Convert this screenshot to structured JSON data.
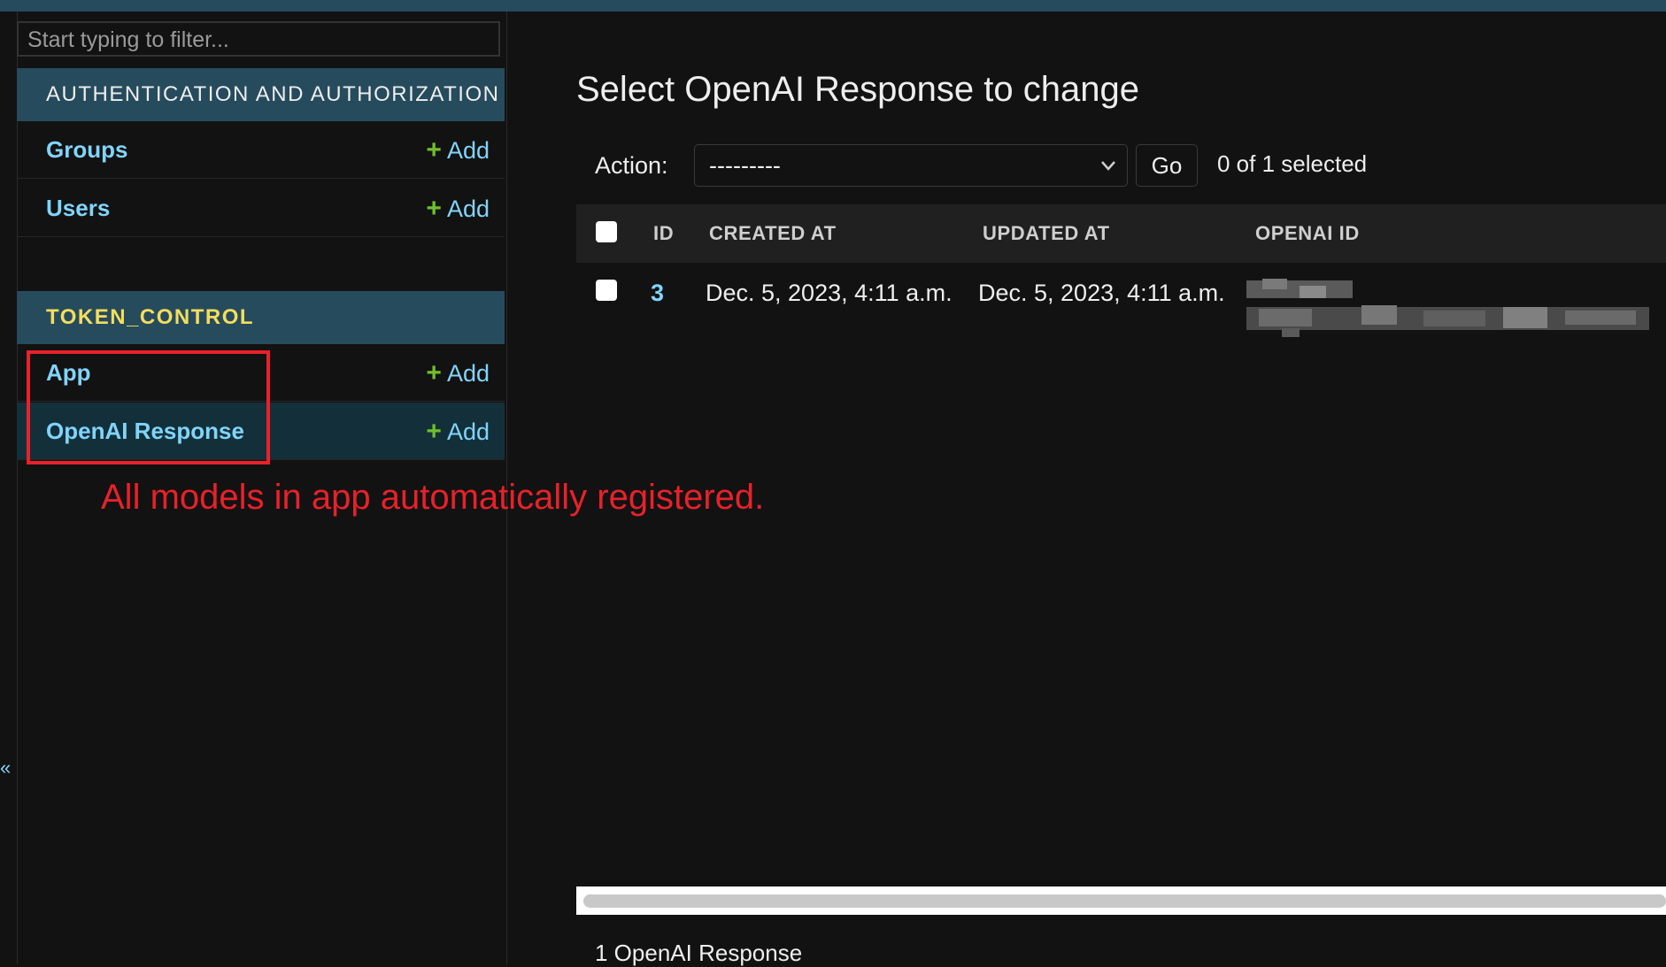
{
  "sidebar": {
    "filter_placeholder": "Start typing to filter...",
    "modules": [
      {
        "name": "AUTHENTICATION AND AUTHORIZATION",
        "items": [
          {
            "label": "Groups",
            "add_label": "Add"
          },
          {
            "label": "Users",
            "add_label": "Add"
          }
        ]
      },
      {
        "name": "TOKEN_CONTROL",
        "items": [
          {
            "label": "App",
            "add_label": "Add"
          },
          {
            "label": "OpenAI Response",
            "add_label": "Add"
          }
        ]
      }
    ],
    "collapse_glyph": "«"
  },
  "annotation": {
    "text": "All models in app automatically registered.",
    "color": "#e8212a"
  },
  "main": {
    "title": "Select OpenAI Response to change",
    "action_label": "Action:",
    "action_select_value": "---------",
    "go_label": "Go",
    "selection_counter": "0 of 1 selected",
    "columns": [
      "ID",
      "CREATED AT",
      "UPDATED AT",
      "OPENAI ID"
    ],
    "rows": [
      {
        "id": "3",
        "created_at": "Dec. 5, 2023, 4:11 a.m.",
        "updated_at": "Dec. 5, 2023, 4:11 a.m."
      }
    ],
    "paginator": "1 OpenAI Response"
  },
  "colors": {
    "header_bar": "#264b5d",
    "link": "#81d4fa",
    "add_plus": "#70bf2b",
    "module_name_highlight": "#f5dd5d"
  }
}
